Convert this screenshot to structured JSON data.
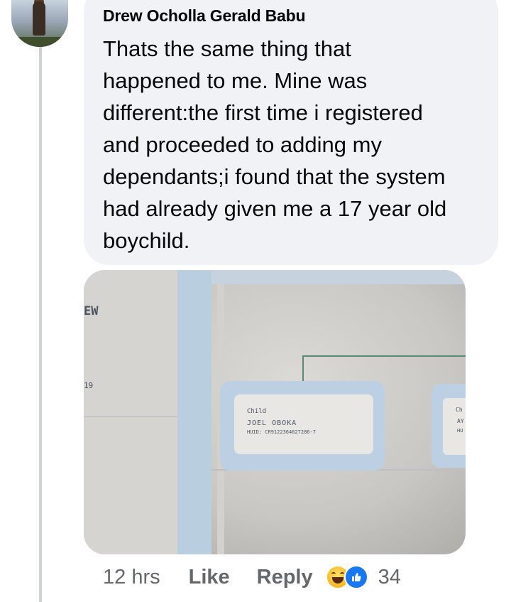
{
  "comment": {
    "author": "Drew Ocholla Gerald Babu",
    "text": "Thats the same thing that\nhappened to me. Mine was\ndifferent:the first time i registered\nand proceeded to adding my\ndependants;i found that the system\nhad already given me a 17 year old\nboychild."
  },
  "photo": {
    "left_label": "EW",
    "left_number": "19",
    "card": {
      "role": "Child",
      "name": "JOEL OBOKA",
      "huid": "HUID: CR9122364627286-7"
    },
    "card2": {
      "role": "Ch",
      "line1": "AY",
      "line2": "HU"
    }
  },
  "actions": {
    "timestamp": "12 hrs",
    "like_label": "Like",
    "reply_label": "Reply",
    "reaction_count": "34",
    "reaction_icons": [
      "haha-icon",
      "like-icon"
    ],
    "colors": {
      "like_blue": "#1877f2",
      "haha_yellow": "#f7b928",
      "muted": "#65676b"
    }
  }
}
